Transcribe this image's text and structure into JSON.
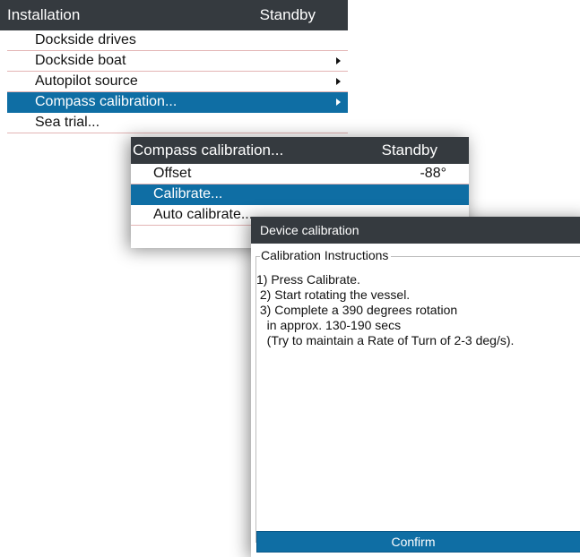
{
  "installation_menu": {
    "title": "Installation",
    "status": "Standby",
    "items": [
      {
        "label": "Dockside drives"
      },
      {
        "label": "Dockside boat"
      },
      {
        "label": "Autopilot source"
      },
      {
        "label": "Compass calibration..."
      },
      {
        "label": "Sea trial..."
      }
    ],
    "selected_index": 3
  },
  "compass_menu": {
    "title": "Compass calibration...",
    "status": "Standby",
    "offset_label": "Offset",
    "offset_value": "-88°",
    "items": [
      {
        "label": "Calibrate..."
      },
      {
        "label": "Auto calibrate..."
      }
    ],
    "selected_index": 0
  },
  "device_dialog": {
    "title": "Device calibration",
    "group_label": "Calibration Instructions",
    "instructions": [
      "1) Press Calibrate.",
      " 2) Start rotating the vessel.",
      " 3) Complete a 390 degrees rotation",
      "   in approx. 130-190 secs",
      "   (Try to maintain a Rate of Turn of 2-3 deg/s)."
    ],
    "confirm_label": "Confirm"
  },
  "colors": {
    "title_bar": "#353a3f",
    "selection": "#0f6ea4",
    "divider": "#e3b5b5"
  },
  "icons": {
    "submenu_arrow": "chevron-right-icon"
  }
}
